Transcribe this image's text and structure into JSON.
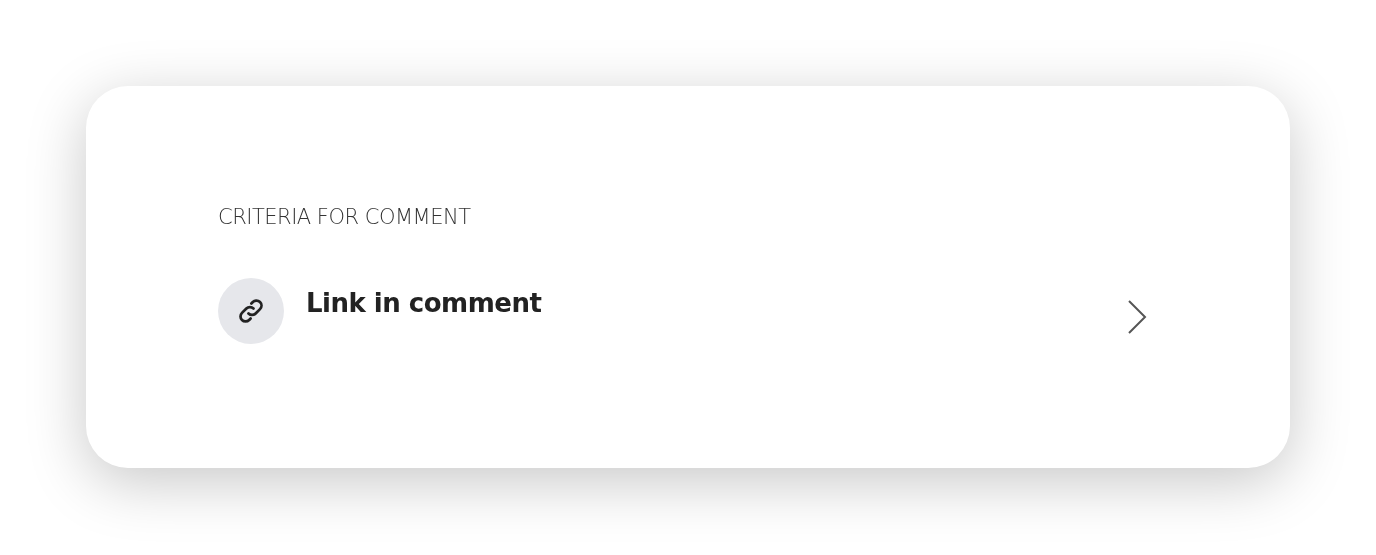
{
  "section": {
    "heading": "CRITERIA FOR COMMENT",
    "items": [
      {
        "label": "Link in comment"
      }
    ]
  }
}
